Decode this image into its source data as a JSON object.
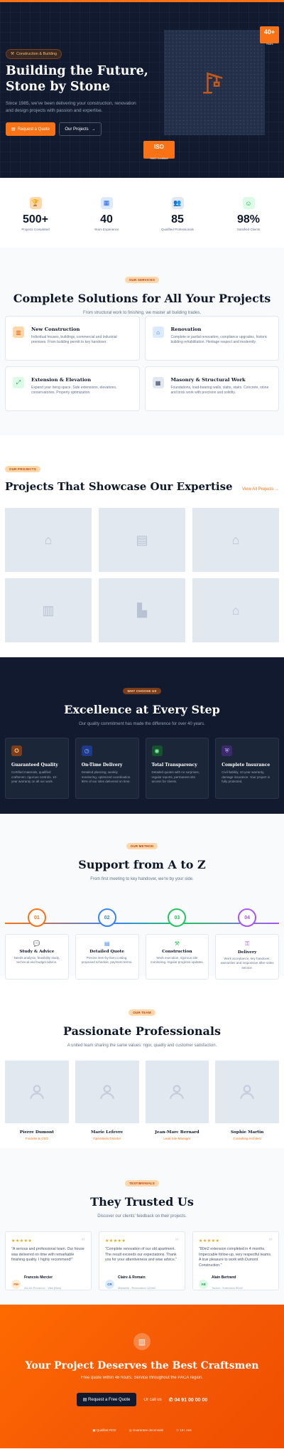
{
  "hero": {
    "badge": "Construction & Building",
    "title_line1": "Building the Future,",
    "title_line2": "Stone by Stone",
    "description": "Since 1985, we've been delivering your construction, renovation and design projects with passion and expertise.",
    "primary_btn": "Request a Quote",
    "secondary_btn": "Our Projects",
    "years_value": "40+",
    "years_label": "Years",
    "iso_title": "ISO",
    "iso_label": "9001 Certified",
    "accent": "#f97316",
    "bg": "#111a2e"
  },
  "stats": [
    {
      "value": "500+",
      "label": "Projects Completed",
      "icon": "trophy-icon",
      "color": "#fed7aa"
    },
    {
      "value": "40",
      "label": "Years Experience",
      "icon": "calendar-icon",
      "color": "#dbeafe"
    },
    {
      "value": "85",
      "label": "Qualified Professionals",
      "icon": "users-icon",
      "color": "#e2e8f0"
    },
    {
      "value": "98%",
      "label": "Satisfied Clients",
      "icon": "smile-icon",
      "color": "#dcfce7"
    }
  ],
  "services": {
    "pill": "OUR SERVICES",
    "title": "Complete Solutions for All Your Projects",
    "subtitle": "From structural work to finishing, we master all building trades.",
    "items": [
      {
        "title": "New Construction",
        "desc": "Individual houses, buildings, commercial and industrial premises. From building permit to key handover.",
        "icon": "building-icon",
        "color": "#fed7aa"
      },
      {
        "title": "Renovation",
        "desc": "Complete or partial renovation, compliance upgrades, historic building rehabilitation. Heritage respect and modernity.",
        "icon": "home-icon",
        "color": "#dbeafe"
      },
      {
        "title": "Extension & Elevation",
        "desc": "Expand your living space. Side extensions, elevations, conservatories. Property optimization.",
        "icon": "expand-icon",
        "color": "#dcfce7"
      },
      {
        "title": "Masonry & Structural Work",
        "desc": "Foundations, load-bearing walls, slabs, stairs. Concrete, stone and brick work with precision and solidity.",
        "icon": "brick-icon",
        "color": "#e2e8f0"
      }
    ]
  },
  "projects": {
    "pill": "OUR PROJECTS",
    "title": "Projects That Showcase Our Expertise",
    "link": "View All Projects"
  },
  "excellence": {
    "pill": "WHY CHOOSE US",
    "title": "Excellence at Every Step",
    "subtitle": "Our quality commitment has made the difference for over 40 years.",
    "items": [
      {
        "title": "Guaranteed Quality",
        "desc": "Certified materials, qualified craftsmen, rigorous controls. 10-year warranty on all our work.",
        "icon": "medal-icon",
        "color": "#7c3d1a"
      },
      {
        "title": "On-Time Delivery",
        "desc": "Detailed planning, weekly monitoring, optimized coordination. 95% of our sites delivered on time.",
        "icon": "clock-icon",
        "color": "#1e3a8a"
      },
      {
        "title": "Total Transparency",
        "desc": "Detailed quotes with no surprises, regular reports, permanent site access for clients.",
        "icon": "eye-icon",
        "color": "#14532d"
      },
      {
        "title": "Complete Insurance",
        "desc": "Civil liability, 10-year warranty, damage insurance. Your project is fully protected.",
        "icon": "shield-icon",
        "color": "#3b2a6b"
      }
    ]
  },
  "process": {
    "pill": "OUR METHOD",
    "title": "Support from A to Z",
    "subtitle": "From first meeting to key handover, we're by your side.",
    "steps": [
      {
        "num": "01",
        "title": "Study & Advice",
        "desc": "Needs analysis, feasibility study, technical and budget advice.",
        "icon": "chat-icon",
        "color": "#f97316"
      },
      {
        "num": "02",
        "title": "Detailed Quote",
        "desc": "Precise item-by-item costing, proposed schedule, payment terms.",
        "icon": "document-icon",
        "color": "#3b82f6"
      },
      {
        "num": "03",
        "title": "Construction",
        "desc": "Work execution, rigorous site monitoring, regular progress updates.",
        "icon": "tools-icon",
        "color": "#22c55e"
      },
      {
        "num": "04",
        "title": "Delivery",
        "desc": "Work acceptance, key handover, warranties and responsive after-sales service.",
        "icon": "key-icon",
        "color": "#a855f7"
      }
    ]
  },
  "team": {
    "pill": "OUR TEAM",
    "title": "Passionate Professionals",
    "subtitle": "A united team sharing the same values: rigor, quality and customer satisfaction.",
    "members": [
      {
        "name": "Pierre Dumont",
        "role": "Founder & CEO"
      },
      {
        "name": "Marie Lefevre",
        "role": "Operations Director"
      },
      {
        "name": "Jean-Marc Bernard",
        "role": "Lead Site Manager"
      },
      {
        "name": "Sophie Martin",
        "role": "Consulting Architect"
      }
    ]
  },
  "testimonials": {
    "pill": "TESTIMONIALS",
    "title": "They Trusted Us",
    "subtitle": "Discover our clients' feedback on their projects.",
    "items": [
      {
        "quote": "\"A serious and professional team. Our house was delivered on time with remarkable finishing quality. I highly recommend!\"",
        "initials": "FM",
        "name": "Francois Mercier",
        "place": "Aix-en-Provence - Villa (New)",
        "av_bg": "#ffedd5",
        "av_fg": "#ea580c"
      },
      {
        "quote": "\"Complete renovation of our old apartment. The result exceeds our expectations. Thank you for your attentiveness and wise advice.\"",
        "initials": "CR",
        "name": "Claire & Romain",
        "place": "Marseille - Renovation 120m2",
        "av_bg": "#dbeafe",
        "av_fg": "#2563eb"
      },
      {
        "quote": "\"80m2 extension completed in 4 months. Impeccable follow-up, very respectful teams. A true pleasure to work with Dumont Construction.\"",
        "initials": "AB",
        "name": "Alain Bertrand",
        "place": "Toulon - Extension 80m2",
        "av_bg": "#dcfce7",
        "av_fg": "#16a34a"
      }
    ],
    "stars": "★★★★★"
  },
  "cta": {
    "title": "Your Project Deserves the Best Craftsmen",
    "subtitle": "Free quote within 48 hours. Service throughout the PACA region.",
    "button": "Request a Free Quote",
    "or": "Or call us",
    "phone": "04 91 00 00 00",
    "features": [
      "Qualibat RGE",
      "Guarantee decennale",
      "10+ Ans"
    ]
  }
}
